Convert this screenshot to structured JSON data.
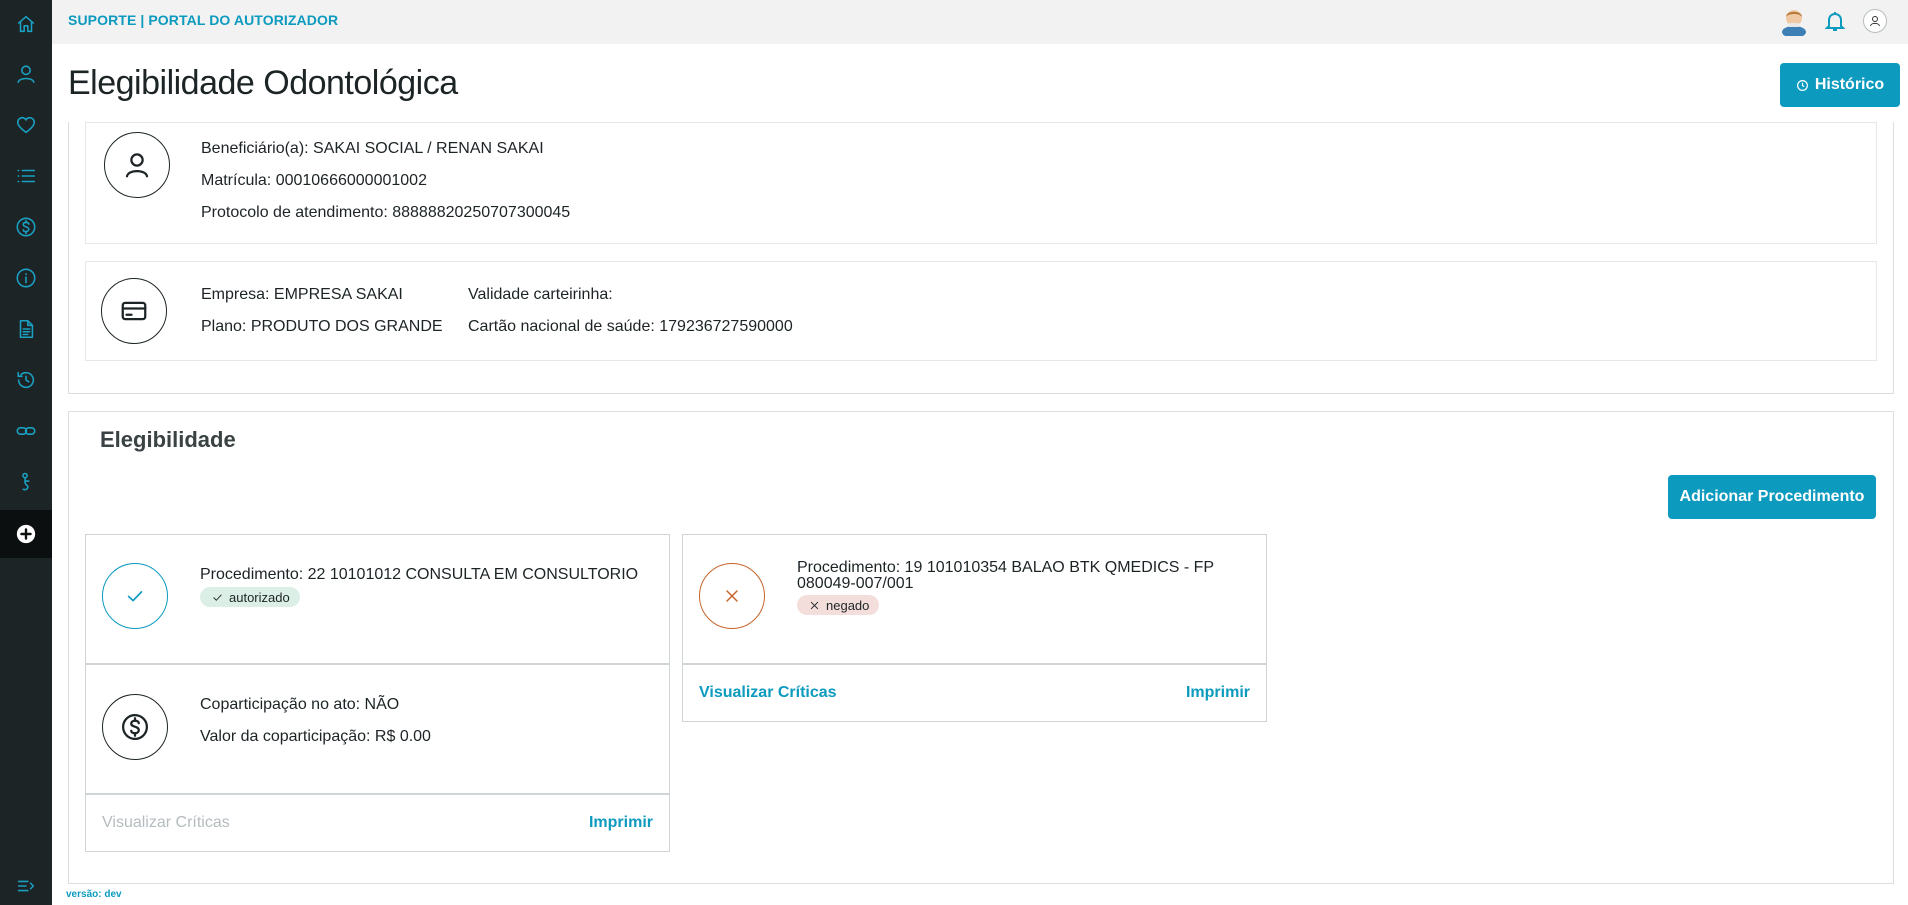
{
  "app": {
    "brand": "SUPORTE | PORTAL DO AUTORIZADOR",
    "version": "versão: dev"
  },
  "sidebar": {
    "items": [
      {
        "icon": "home-icon"
      },
      {
        "icon": "user-icon"
      },
      {
        "icon": "heart-icon"
      },
      {
        "icon": "list-icon"
      },
      {
        "icon": "dollar-icon"
      },
      {
        "icon": "info-icon"
      },
      {
        "icon": "document-icon"
      },
      {
        "icon": "history-icon"
      },
      {
        "icon": "link-icon"
      },
      {
        "icon": "person-walk-icon"
      },
      {
        "icon": "plus-circle-icon",
        "active": true
      }
    ],
    "collapse_icon": "menu-collapse-icon"
  },
  "page": {
    "title": "Elegibilidade Odontológica",
    "history_button": "Histórico"
  },
  "beneficiary": {
    "name": "Beneficiário(a): SAKAI SOCIAL / RENAN SAKAI",
    "registration": "Matrícula: 00010666000001002",
    "protocol": "Protocolo de atendimento: 88888820250707300045"
  },
  "contract": {
    "company": "Empresa: EMPRESA SAKAI",
    "plan": "Plano: PRODUTO DOS GRANDE",
    "card_validity": "Validade carteirinha:",
    "national_card": "Cartão nacional de saúde: 179236727590000"
  },
  "eligibility": {
    "section_title": "Elegibilidade",
    "add_button": "Adicionar Procedimento",
    "procedures": [
      {
        "text": "Procedimento: 22 10101012 CONSULTA EM CONSULTORIO",
        "status": "autorizado",
        "copay_at_act": "Coparticipação no ato: NÃO",
        "copay_value": "Valor da coparticipação: R$ 0.00",
        "view_criticas": "Visualizar Críticas",
        "print": "Imprimir"
      },
      {
        "text_line1": "Procedimento: 19 101010354 BALAO BTK QMEDICS - FP",
        "text_line2": "080049-007/001",
        "status": "negado",
        "view_criticas": "Visualizar Críticas",
        "print": "Imprimir"
      }
    ]
  },
  "colors": {
    "primary": "#0c9abe",
    "sidebar_bg": "#1d2426",
    "approved": "#0c9abe",
    "denied": "#c8652a"
  }
}
